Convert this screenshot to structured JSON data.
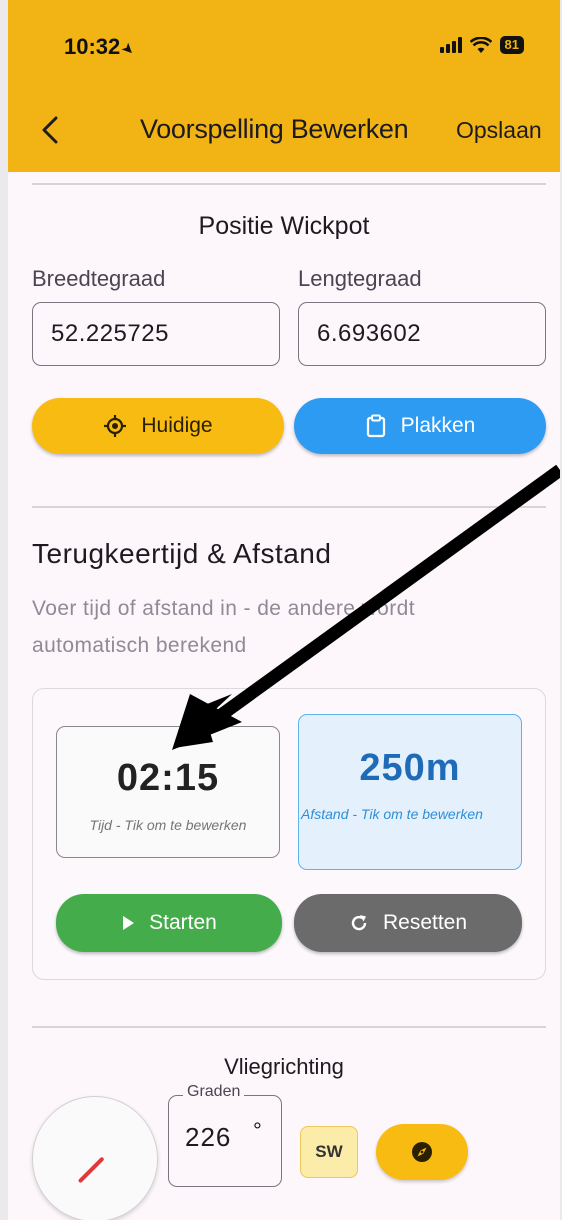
{
  "status_bar": {
    "time": "10:32",
    "battery": "81"
  },
  "app_bar": {
    "title": "Voorspelling Bewerken",
    "save_label": "Opslaan"
  },
  "position_section": {
    "title": "Positie Wickpot",
    "latitude_label": "Breedtegraad",
    "latitude_value": "52.225725",
    "longitude_label": "Lengtegraad",
    "longitude_value": "6.693602",
    "current_button": "Huidige",
    "paste_button": "Plakken"
  },
  "return_section": {
    "title": "Terugkeertijd & Afstand",
    "helper_line1": "Voer tijd of afstand in - de andere wordt",
    "helper_line2": "automatisch berekend",
    "time_value": "02:15",
    "time_caption": "Tijd - Tik om te bewerken",
    "distance_value": "250m",
    "distance_caption": "Afstand - Tik om te bewerken",
    "start_button": "Starten",
    "reset_button": "Resetten"
  },
  "direction_section": {
    "title": "Vliegrichting",
    "degrees_label": "Graden",
    "degrees_value": "226",
    "degrees_unit": "°",
    "cardinal": "SW",
    "compass_button_icon": "compass-icon"
  },
  "colors": {
    "app_bar": "#f2b414",
    "primary_yellow": "#f8bb12",
    "blue": "#2e9bf2",
    "green": "#45ac4c",
    "gray": "#6b6b6b",
    "distance_text": "#1e6bb8",
    "needle": "#e0393c"
  }
}
